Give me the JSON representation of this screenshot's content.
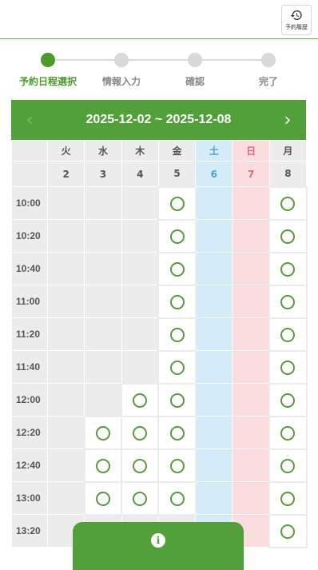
{
  "header": {
    "history_label": "予約履歴",
    "history_icon": "history-icon"
  },
  "stepper": {
    "steps": [
      {
        "label": "予約日程選択",
        "active": true
      },
      {
        "label": "情報入力",
        "active": false
      },
      {
        "label": "確認",
        "active": false
      },
      {
        "label": "完了",
        "active": false
      }
    ]
  },
  "calendar": {
    "range": "2025-12-02 ~ 2025-12-08",
    "prev_icon": "chevron-left-icon",
    "next_icon": "chevron-right-icon",
    "days": [
      {
        "weekday": "火",
        "date": "2",
        "type": "weekday"
      },
      {
        "weekday": "水",
        "date": "3",
        "type": "weekday"
      },
      {
        "weekday": "木",
        "date": "4",
        "type": "weekday"
      },
      {
        "weekday": "金",
        "date": "5",
        "type": "weekday"
      },
      {
        "weekday": "土",
        "date": "6",
        "type": "sat"
      },
      {
        "weekday": "日",
        "date": "7",
        "type": "sun"
      },
      {
        "weekday": "月",
        "date": "8",
        "type": "weekday"
      }
    ],
    "slots": [
      {
        "time": "10:00",
        "avail": [
          0,
          0,
          0,
          1,
          0,
          0,
          1
        ]
      },
      {
        "time": "10:20",
        "avail": [
          0,
          0,
          0,
          1,
          0,
          0,
          1
        ]
      },
      {
        "time": "10:40",
        "avail": [
          0,
          0,
          0,
          1,
          0,
          0,
          1
        ]
      },
      {
        "time": "11:00",
        "avail": [
          0,
          0,
          0,
          1,
          0,
          0,
          1
        ]
      },
      {
        "time": "11:20",
        "avail": [
          0,
          0,
          0,
          1,
          0,
          0,
          1
        ]
      },
      {
        "time": "11:40",
        "avail": [
          0,
          0,
          0,
          1,
          0,
          0,
          1
        ]
      },
      {
        "time": "12:00",
        "avail": [
          0,
          0,
          1,
          1,
          0,
          0,
          1
        ]
      },
      {
        "time": "12:20",
        "avail": [
          0,
          1,
          1,
          1,
          0,
          0,
          1
        ]
      },
      {
        "time": "12:40",
        "avail": [
          0,
          1,
          1,
          1,
          0,
          0,
          1
        ]
      },
      {
        "time": "13:00",
        "avail": [
          0,
          1,
          1,
          1,
          0,
          0,
          1
        ]
      },
      {
        "time": "13:20",
        "avail": [
          0,
          0,
          0,
          0,
          0,
          0,
          1
        ]
      }
    ],
    "available_symbol": "○"
  },
  "fab": {
    "icon": "info-icon",
    "glyph": "i"
  }
}
